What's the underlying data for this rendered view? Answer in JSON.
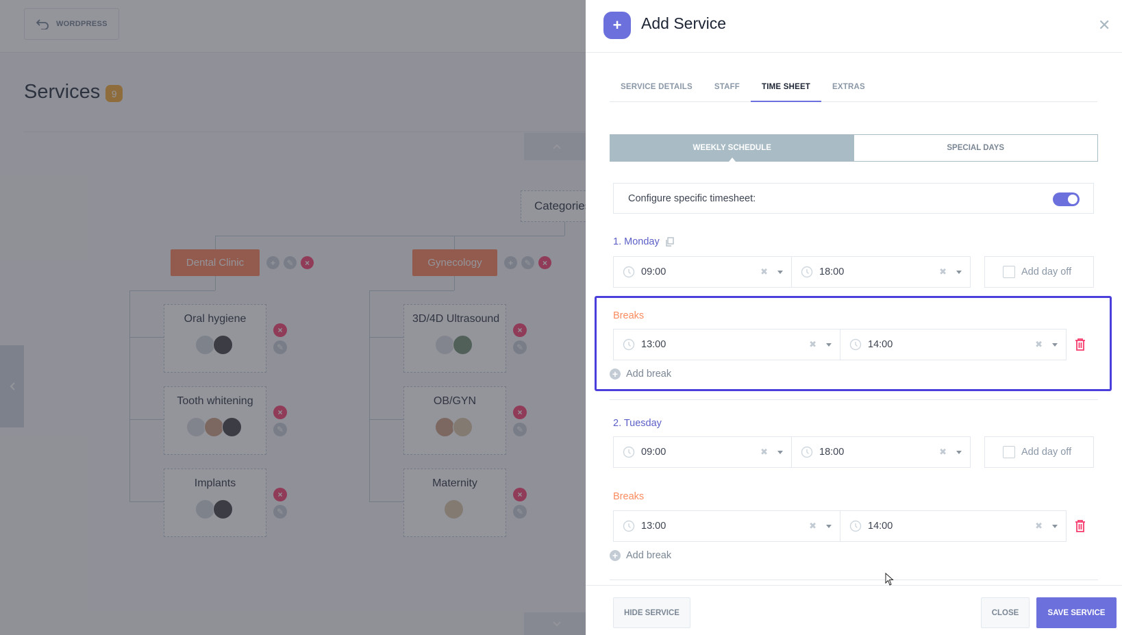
{
  "background": {
    "back_button": "WORDPRESS",
    "page_title": "Services",
    "services_count": "9",
    "root_category": "Categories",
    "categories": [
      {
        "name": "Dental Clinic",
        "services": [
          {
            "name": "Oral hygiene",
            "staff_count": 2
          },
          {
            "name": "Tooth whitening",
            "staff_count": 3
          },
          {
            "name": "Implants",
            "staff_count": 2
          }
        ]
      },
      {
        "name": "Gynecology",
        "services": [
          {
            "name": "3D/4D Ultrasound",
            "staff_count": 2
          },
          {
            "name": "OB/GYN",
            "staff_count": 2
          },
          {
            "name": "Maternity",
            "staff_count": 1
          }
        ]
      }
    ]
  },
  "panel": {
    "title": "Add Service",
    "tabs": [
      {
        "label": "SERVICE DETAILS",
        "active": false
      },
      {
        "label": "STAFF",
        "active": false
      },
      {
        "label": "TIME SHEET",
        "active": true
      },
      {
        "label": "EXTRAS",
        "active": false
      }
    ],
    "schedule_tabs": [
      {
        "label": "WEEKLY SCHEDULE",
        "active": true
      },
      {
        "label": "SPECIAL DAYS",
        "active": false
      }
    ],
    "configure_label": "Configure specific timesheet:",
    "configure_enabled": true,
    "days": [
      {
        "label": "1. Monday",
        "start": "09:00",
        "end": "18:00",
        "day_off_label": "Add day off",
        "day_off": false,
        "breaks_label": "Breaks",
        "breaks": [
          {
            "start": "13:00",
            "end": "14:00"
          }
        ],
        "add_break_label": "Add break"
      },
      {
        "label": "2. Tuesday",
        "start": "09:00",
        "end": "18:00",
        "day_off_label": "Add day off",
        "day_off": false,
        "breaks_label": "Breaks",
        "breaks": [
          {
            "start": "13:00",
            "end": "14:00"
          }
        ],
        "add_break_label": "Add break"
      }
    ],
    "footer": {
      "hide_label": "HIDE SERVICE",
      "close_label": "CLOSE",
      "save_label": "SAVE SERVICE"
    }
  },
  "colors": {
    "accent": "#6c70dc",
    "category": "#fc7c54",
    "danger": "#f73b6c",
    "breaks": "#fb8b60",
    "highlight": "#4b3fdc"
  }
}
